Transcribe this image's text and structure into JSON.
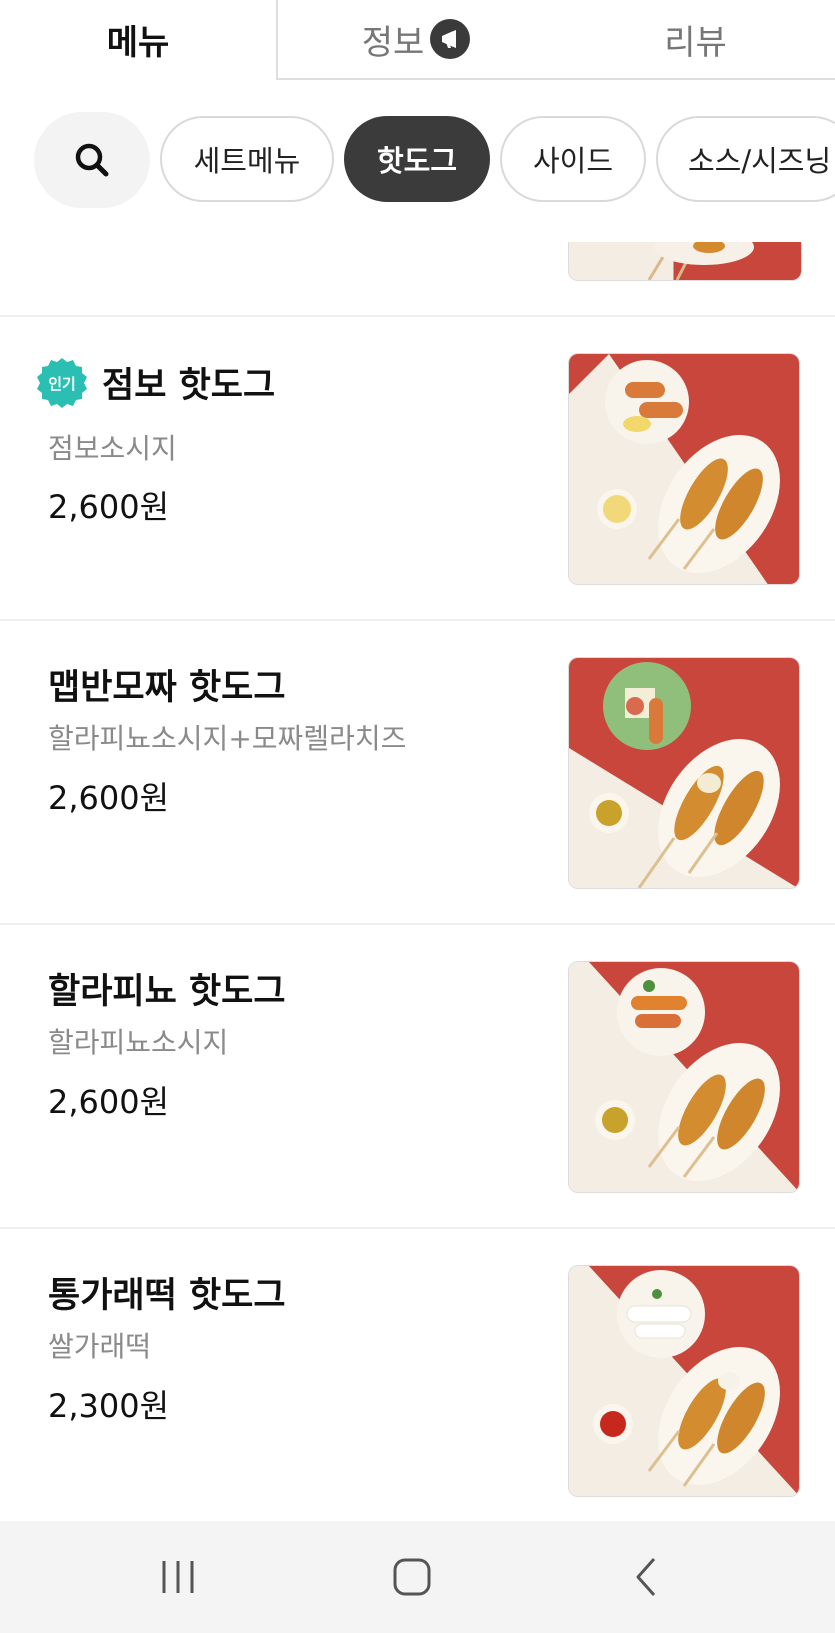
{
  "tabs": [
    {
      "label": "메뉴",
      "active": true
    },
    {
      "label": "정보",
      "active": false
    },
    {
      "label": "리뷰",
      "active": false
    }
  ],
  "search": {
    "icon": "search-icon"
  },
  "categories": [
    {
      "label": "세트메뉴",
      "active": false
    },
    {
      "label": "핫도그",
      "active": true
    },
    {
      "label": "사이드",
      "active": false
    },
    {
      "label": "소스/시즈닝",
      "active": false
    }
  ],
  "items": [
    {
      "badge": "인기",
      "name": "점보 핫도그",
      "desc": "점보소시지",
      "price": "2,600원"
    },
    {
      "badge": "",
      "name": "맵반모짜 핫도그",
      "desc": "할라피뇨소시지+모짜렐라치즈",
      "price": "2,600원"
    },
    {
      "badge": "",
      "name": "할라피뇨 핫도그",
      "desc": "할라피뇨소시지",
      "price": "2,600원"
    },
    {
      "badge": "",
      "name": "통가래떡 핫도그",
      "desc": "쌀가래떡",
      "price": "2,300원"
    }
  ],
  "colors": {
    "accent_dark": "#3b3b3b",
    "badge_teal": "#2bbfb3",
    "food_red": "#c9463c"
  },
  "navbar": {
    "icons": [
      "recent-apps-icon",
      "home-icon",
      "back-icon"
    ]
  }
}
